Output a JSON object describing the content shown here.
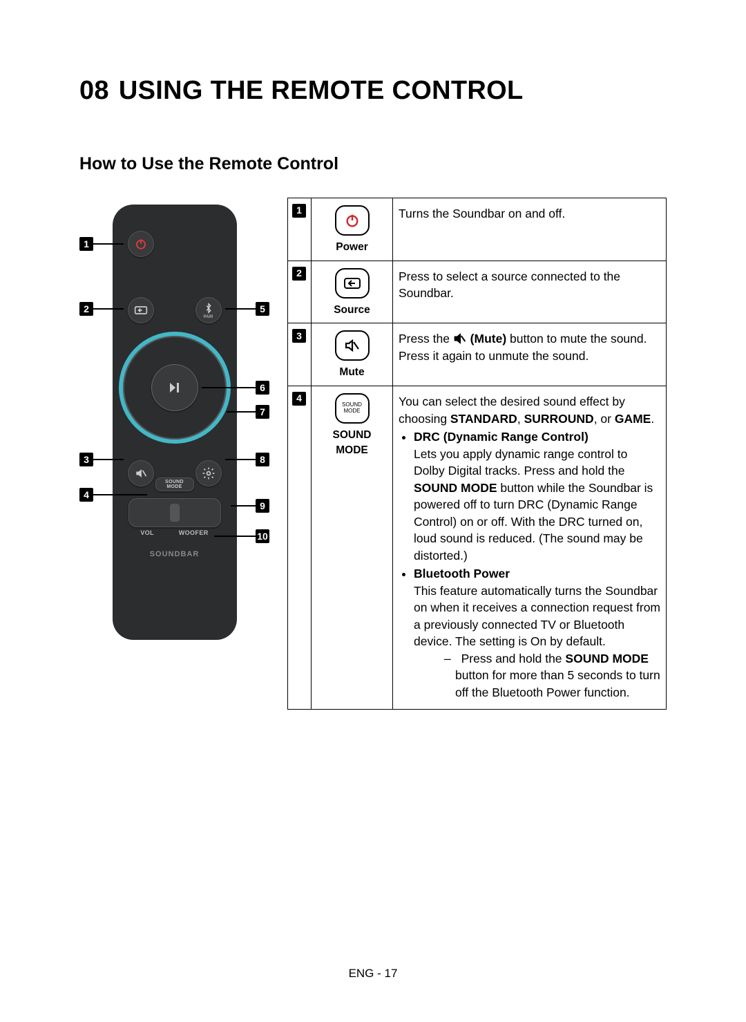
{
  "section_number": "08",
  "section_title": "USING THE REMOTE CONTROL",
  "sub_title": "How to Use the Remote Control",
  "remote": {
    "pair_label": "PAIR",
    "sound_mode_btn_line1": "SOUND",
    "sound_mode_btn_line2": "MODE",
    "rocker_left": "VOL",
    "rocker_right": "WOOFER",
    "brand": "SOUNDBAR"
  },
  "callouts": {
    "c1": "1",
    "c2": "2",
    "c3": "3",
    "c4": "4",
    "c5": "5",
    "c6": "6",
    "c7": "7",
    "c8": "8",
    "c9": "9",
    "c10": "10"
  },
  "rows": [
    {
      "num": "1",
      "label": "Power",
      "desc": "Turns the Soundbar on and off."
    },
    {
      "num": "2",
      "label": "Source",
      "desc": "Press to select a source connected to the Soundbar."
    },
    {
      "num": "3",
      "label": "Mute",
      "desc_pre": "Press the ",
      "desc_bold": "(Mute)",
      "desc_post": " button to mute the sound. Press it again to unmute the sound."
    },
    {
      "num": "4",
      "label": "SOUND MODE",
      "top_pre": "You can select the desired sound effect by choosing ",
      "b1": "STANDARD",
      "sep1": ", ",
      "b2": "SURROUND",
      "sep2": ", or ",
      "b3": "GAME",
      "tail": ".",
      "bullet1_title": "DRC (Dynamic Range Control)",
      "bullet1_body_pre": "Lets you apply dynamic range control to Dolby Digital tracks. Press and hold the ",
      "bullet1_bold": "SOUND MODE",
      "bullet1_body_post": " button while the Soundbar is powered off to turn DRC (Dynamic Range Control) on or off. With the DRC turned on, loud sound is reduced. (The sound may be distorted.)",
      "bullet2_title": "Bluetooth Power",
      "bullet2_body": "This feature automatically turns the Soundbar on when it receives a connection request from a previously connected TV or Bluetooth device. The setting is On by default.",
      "dash_pre": "Press and hold the ",
      "dash_bold": "SOUND MODE",
      "dash_post": " button for more than 5 seconds to turn off the Bluetooth Power function."
    }
  ],
  "footer": "ENG - 17"
}
